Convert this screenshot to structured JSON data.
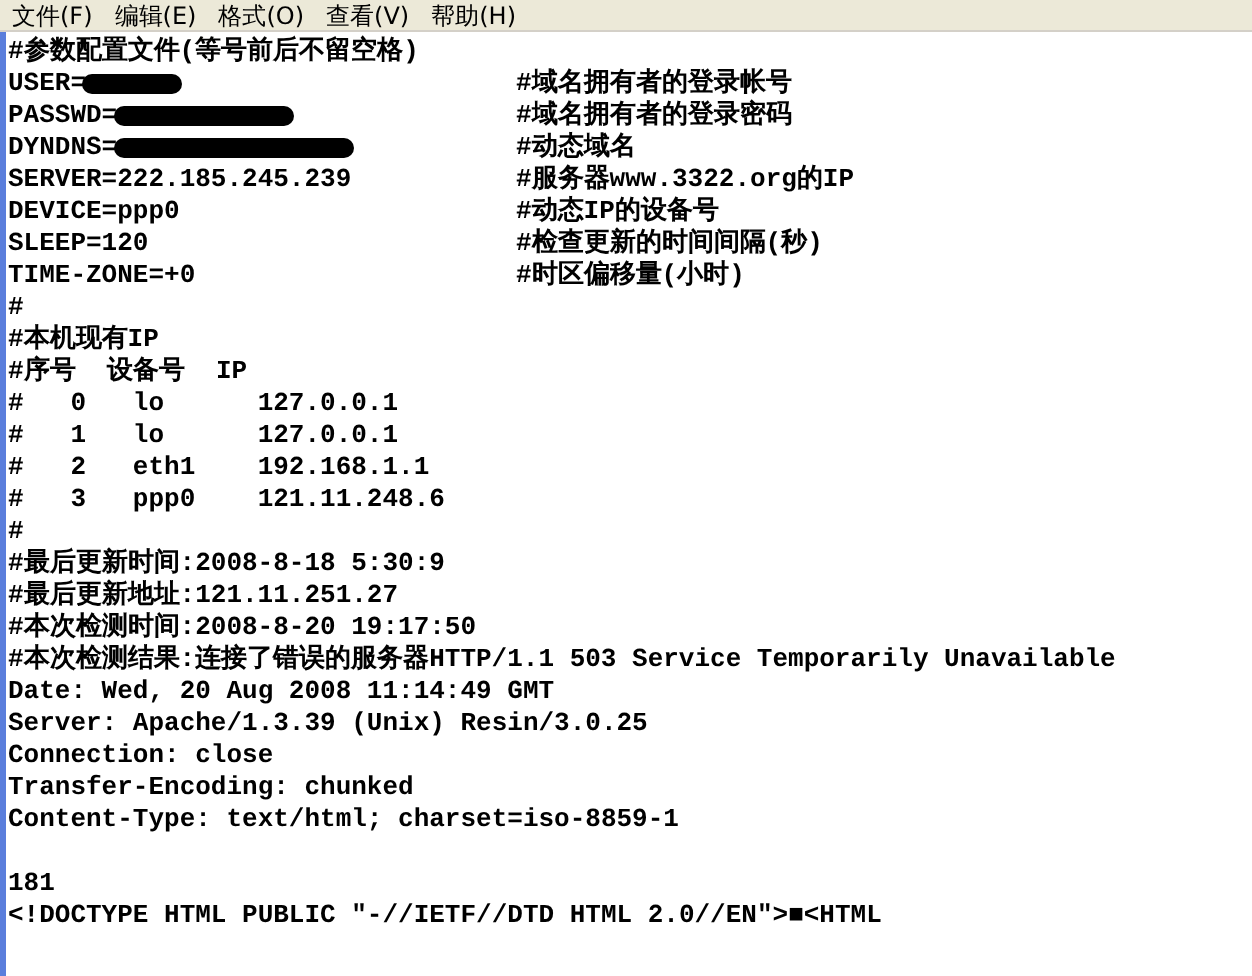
{
  "menu": [
    "文件(F)",
    "编辑(E)",
    "格式(O)",
    "查看(V)",
    "帮助(H)"
  ],
  "lines": [
    {
      "kind": "text",
      "text": "#参数配置文件(等号前后不留空格)"
    },
    {
      "kind": "setting",
      "text": "USER=",
      "redacted": true,
      "comment": "#域名拥有者的登录帐号"
    },
    {
      "kind": "setting",
      "text": "PASSWD=",
      "redacted": true,
      "comment": "#域名拥有者的登录密码"
    },
    {
      "kind": "setting",
      "text": "DYNDNS=",
      "redacted": true,
      "comment": "#动态域名"
    },
    {
      "kind": "setting",
      "text": "SERVER=222.185.245.239",
      "redacted": false,
      "comment": "#服务器www.3322.org的IP"
    },
    {
      "kind": "setting",
      "text": "DEVICE=ppp0",
      "redacted": false,
      "comment": "#动态IP的设备号"
    },
    {
      "kind": "setting",
      "text": "SLEEP=120",
      "redacted": false,
      "comment": "#检查更新的时间间隔(秒)"
    },
    {
      "kind": "setting",
      "text": "TIME-ZONE=+0",
      "redacted": false,
      "comment": "#时区偏移量(小时)"
    },
    {
      "kind": "text",
      "text": "#"
    },
    {
      "kind": "text",
      "text": "#本机现有IP"
    },
    {
      "kind": "text",
      "text": "#序号  设备号  IP"
    },
    {
      "kind": "text",
      "text": "#   0   lo      127.0.0.1"
    },
    {
      "kind": "text",
      "text": "#   1   lo      127.0.0.1"
    },
    {
      "kind": "text",
      "text": "#   2   eth1    192.168.1.1"
    },
    {
      "kind": "text",
      "text": "#   3   ppp0    121.11.248.6"
    },
    {
      "kind": "text",
      "text": "#"
    },
    {
      "kind": "text",
      "text": "#最后更新时间:2008-8-18 5:30:9"
    },
    {
      "kind": "text",
      "text": "#最后更新地址:121.11.251.27"
    },
    {
      "kind": "text",
      "text": "#本次检测时间:2008-8-20 19:17:50"
    },
    {
      "kind": "text",
      "text": "#本次检测结果:连接了错误的服务器HTTP/1.1 503 Service Temporarily Unavailable"
    },
    {
      "kind": "text",
      "text": "Date: Wed, 20 Aug 2008 11:14:49 GMT"
    },
    {
      "kind": "text",
      "text": "Server: Apache/1.3.39 (Unix) Resin/3.0.25"
    },
    {
      "kind": "text",
      "text": "Connection: close"
    },
    {
      "kind": "text",
      "text": "Transfer-Encoding: chunked"
    },
    {
      "kind": "text",
      "text": "Content-Type: text/html; charset=iso-8859-1"
    },
    {
      "kind": "blank"
    },
    {
      "kind": "text",
      "text": "181"
    },
    {
      "kind": "text",
      "text": "<!DOCTYPE HTML PUBLIC \"-//IETF//DTD HTML 2.0//EN\">■<HTML"
    }
  ]
}
